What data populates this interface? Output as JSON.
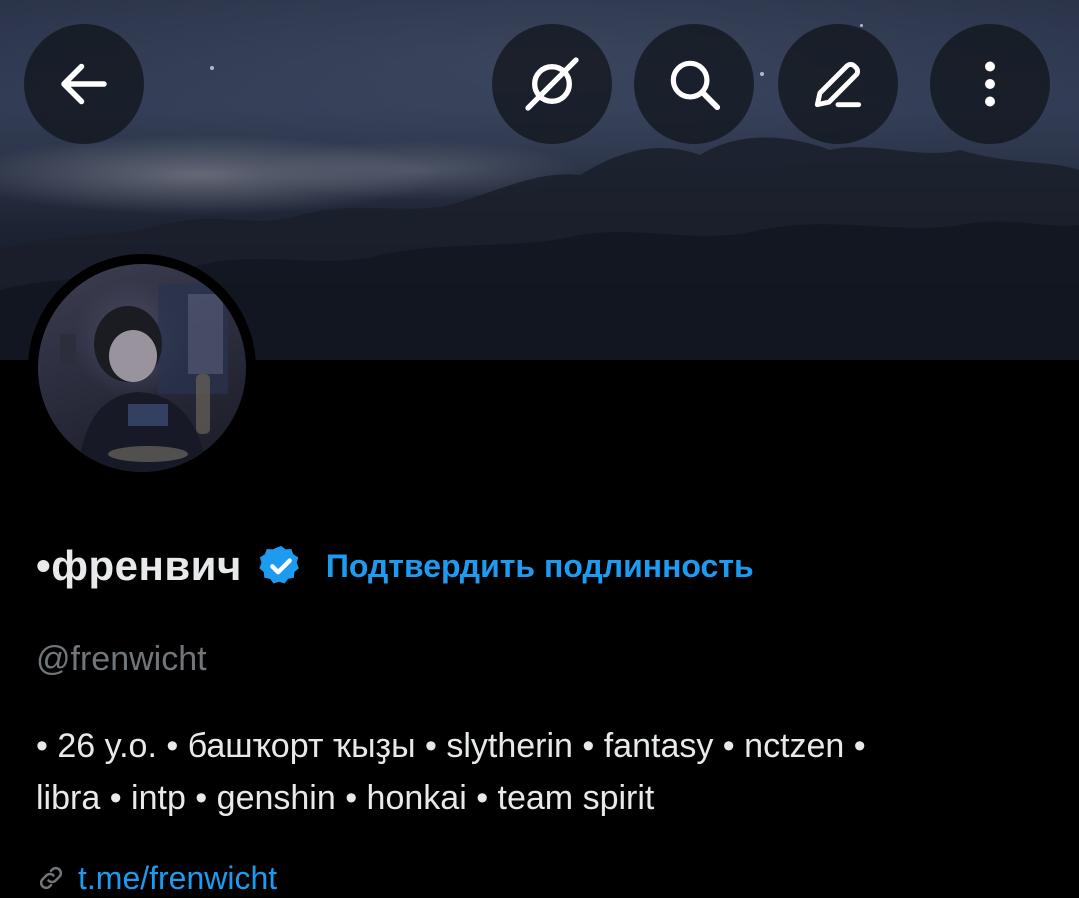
{
  "header": {
    "back_icon": "arrow-left-icon",
    "hide_icon": "eye-slash-grok-icon",
    "search_icon": "search-icon",
    "edit_icon": "pencil-icon",
    "more_icon": "more-vertical-icon"
  },
  "profile": {
    "display_name": "•френвич",
    "verified": true,
    "verify_link": "Подтвердить подлинность",
    "handle": "@frenwicht",
    "bio_line1": "• 26 y.o. • башҡорт ҡыҙы • slytherin • fantasy • nctzen •",
    "bio_line2": "libra • intp • genshin • honkai • team spirit",
    "link_partial": "t.me/frenwicht"
  },
  "colors": {
    "accent": "#1d9bf0",
    "background": "#000000",
    "text_primary": "#e7e9ea",
    "text_secondary": "#71767b"
  }
}
